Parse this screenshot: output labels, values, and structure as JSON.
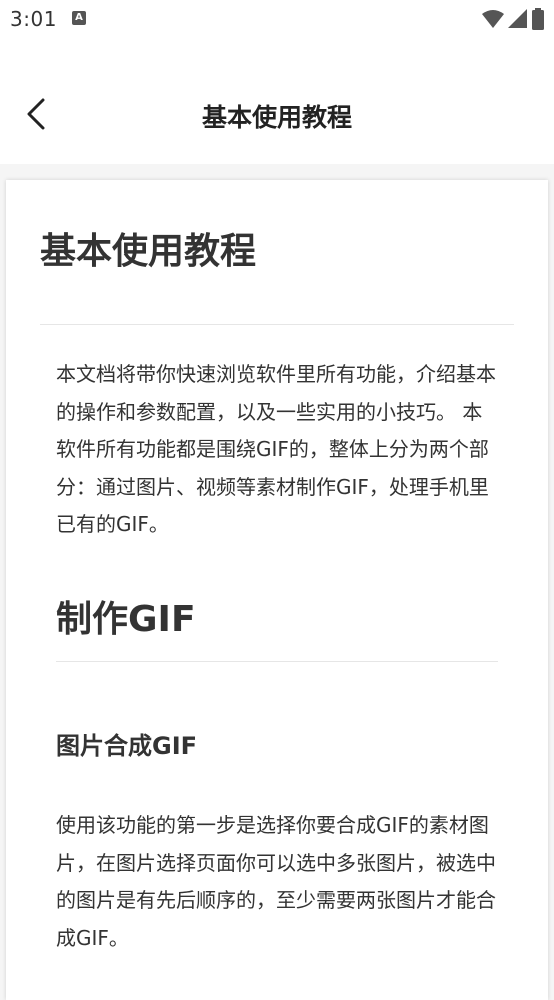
{
  "status_bar": {
    "time": "3:01",
    "notification_icon": "A",
    "icons": [
      "wifi-icon",
      "signal-icon",
      "battery-icon"
    ]
  },
  "app_bar": {
    "title": "基本使用教程",
    "back_icon": "chevron-left-icon"
  },
  "document": {
    "title": "基本使用教程",
    "intro": "本文档将带你快速浏览软件里所有功能，介绍基本的操作和参数配置，以及一些实用的小技巧。 本软件所有功能都是围绕GIF的，整体上分为两个部分：通过图片、视频等素材制作GIF，处理手机里已有的GIF。",
    "section_heading": "制作GIF",
    "subsection_heading": "图片合成GIF",
    "subsection_paragraph": "使用该功能的第一步是选择你要合成GIF的素材图片，在图片选择页面你可以选中多张图片，被选中的图片是有先后顺序的，至少需要两张图片才能合成GIF。"
  }
}
